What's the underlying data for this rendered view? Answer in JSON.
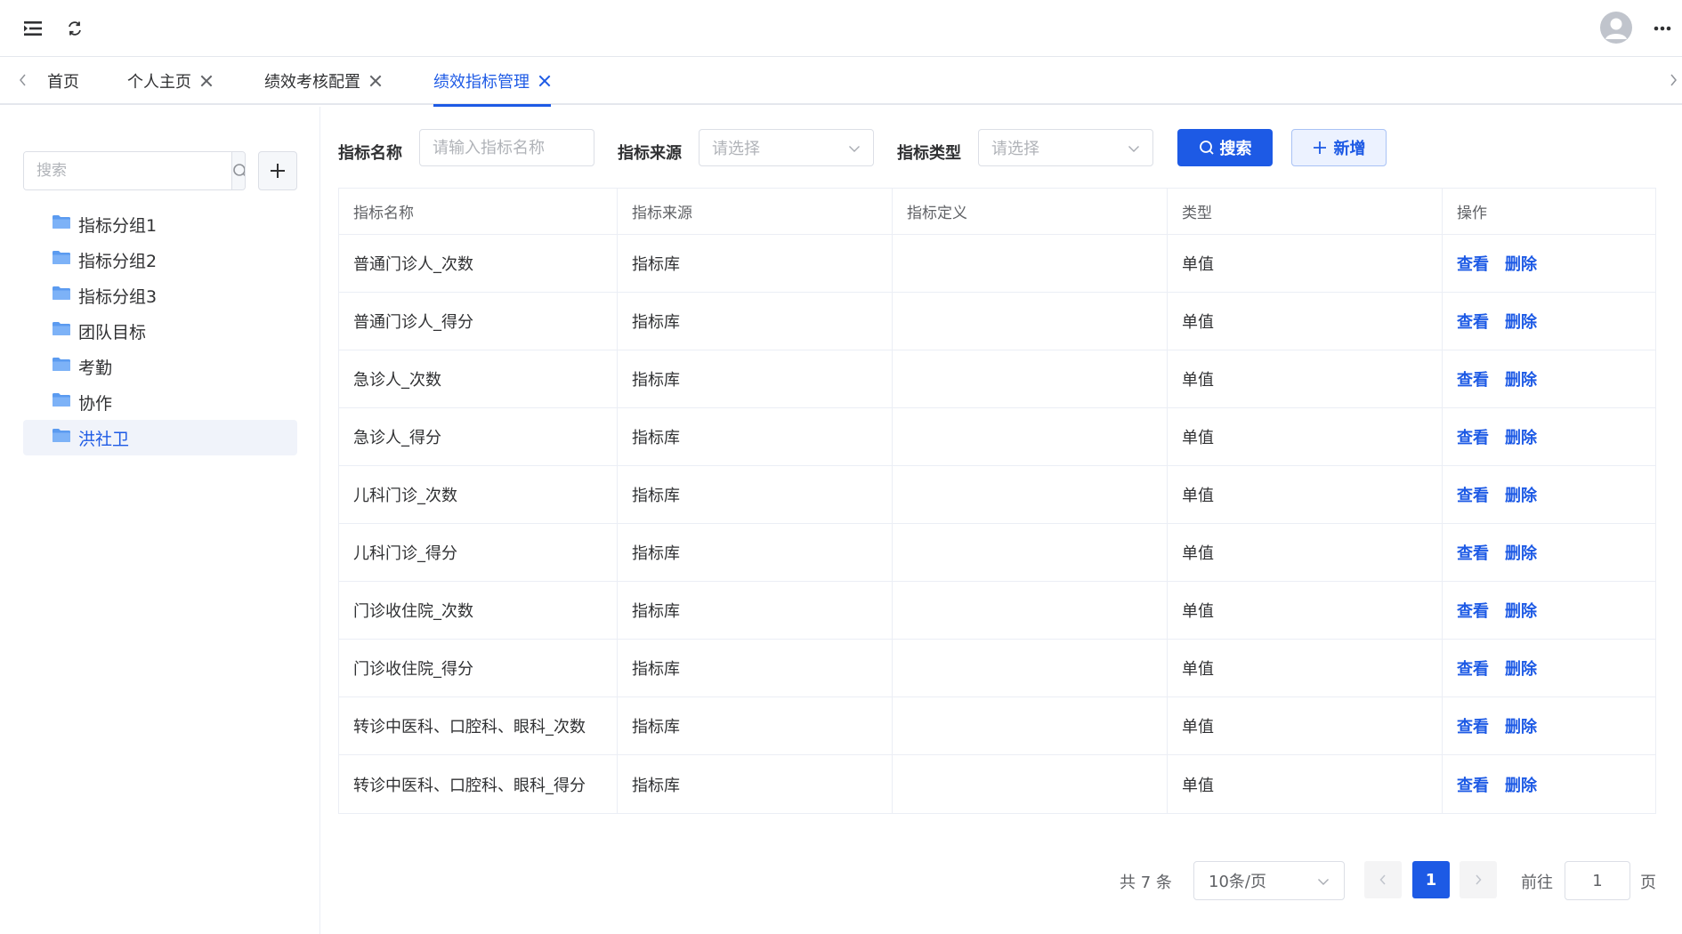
{
  "tabs": [
    {
      "label": "首页",
      "closable": false,
      "active": false
    },
    {
      "label": "个人主页",
      "closable": true,
      "active": false
    },
    {
      "label": "绩效考核配置",
      "closable": true,
      "active": false
    },
    {
      "label": "绩效指标管理",
      "closable": true,
      "active": true
    }
  ],
  "sidebar": {
    "search_placeholder": "搜索",
    "tree": [
      {
        "label": "指标分组1",
        "selected": false
      },
      {
        "label": "指标分组2",
        "selected": false
      },
      {
        "label": "指标分组3",
        "selected": false
      },
      {
        "label": "团队目标",
        "selected": false
      },
      {
        "label": "考勤",
        "selected": false
      },
      {
        "label": "协作",
        "selected": false
      },
      {
        "label": "洪社卫",
        "selected": true
      }
    ]
  },
  "filters": {
    "name_label": "指标名称",
    "name_placeholder": "请输入指标名称",
    "source_label": "指标来源",
    "source_placeholder": "请选择",
    "type_label": "指标类型",
    "type_placeholder": "请选择",
    "search_button": "搜索",
    "add_button": "新增"
  },
  "table": {
    "columns": [
      "指标名称",
      "指标来源",
      "指标定义",
      "类型",
      "操作"
    ],
    "rows": [
      {
        "name": "普通门诊人_次数",
        "source": "指标库",
        "definition": "",
        "type": "单值"
      },
      {
        "name": "普通门诊人_得分",
        "source": "指标库",
        "definition": "",
        "type": "单值"
      },
      {
        "name": "急诊人_次数",
        "source": "指标库",
        "definition": "",
        "type": "单值"
      },
      {
        "name": "急诊人_得分",
        "source": "指标库",
        "definition": "",
        "type": "单值"
      },
      {
        "name": "儿科门诊_次数",
        "source": "指标库",
        "definition": "",
        "type": "单值"
      },
      {
        "name": "儿科门诊_得分",
        "source": "指标库",
        "definition": "",
        "type": "单值"
      },
      {
        "name": "门诊收住院_次数",
        "source": "指标库",
        "definition": "",
        "type": "单值"
      },
      {
        "name": "门诊收住院_得分",
        "source": "指标库",
        "definition": "",
        "type": "单值"
      },
      {
        "name": "转诊中医科、口腔科、眼科_次数",
        "source": "指标库",
        "definition": "",
        "type": "单值"
      },
      {
        "name": "转诊中医科、口腔科、眼科_得分",
        "source": "指标库",
        "definition": "",
        "type": "单值"
      }
    ],
    "action_view": "查看",
    "action_delete": "删除"
  },
  "pagination": {
    "total_text": "共 7 条",
    "page_size": "10条/页",
    "current_page": "1",
    "goto_label": "前往",
    "goto_value": "1",
    "page_suffix": "页"
  },
  "colors": {
    "primary": "#1d5ae5",
    "border": "#dcdfe6",
    "text": "#303133",
    "muted": "#606266"
  }
}
